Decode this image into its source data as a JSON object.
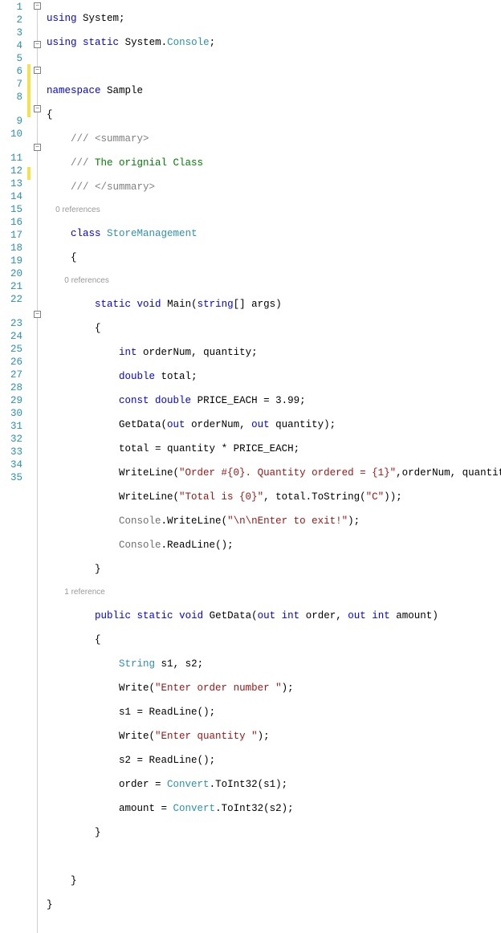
{
  "code": {
    "kw_using": "using",
    "kw_static": "static",
    "kw_namespace": "namespace",
    "kw_class": "class",
    "kw_void": "void",
    "kw_string": "string",
    "kw_int": "int",
    "kw_double": "double",
    "kw_const": "const",
    "kw_out": "out",
    "kw_public": "public",
    "ns_system": "System",
    "ns_console": "Console",
    "ns_name": "Sample",
    "class_name": "StoreManagement",
    "method_main": "Main",
    "method_getdata": "GetData",
    "type_string_cap": "String",
    "type_convert": "Convert",
    "summary_open": "<summary>",
    "summary_close": "</summary>",
    "triple_slash": "/// ",
    "summary_text": "The orignial Class",
    "var_args": "args",
    "var_orderNum": "orderNum",
    "var_quantity": "quantity",
    "var_total": "total",
    "var_price": "PRICE_EACH",
    "var_order": "order",
    "var_amount": "amount",
    "var_s1": "s1",
    "var_s2": "s2",
    "lit_price": "3.99",
    "str_order": "\"Order #{0}. Quantity ordered = {1}\"",
    "str_total": "\"Total is {0}\"",
    "str_c": "\"C\"",
    "str_enter_exit": "\"\\n\\nEnter to exit!\"",
    "str_enter_order": "\"Enter order number \"",
    "str_enter_qty": "\"Enter quantity \"",
    "fn_writeline": "WriteLine",
    "fn_readline": "ReadLine",
    "fn_write": "Write",
    "fn_tostring": "ToString",
    "fn_toint32": "ToInt32",
    "punc_semi": ";",
    "punc_dot": ".",
    "punc_comma": ", ",
    "punc_lbrace": "{",
    "punc_rbrace": "}",
    "punc_lparen": "(",
    "punc_rparen": ")",
    "punc_lbracket": "[",
    "punc_rbracket": "]",
    "punc_eq": " = ",
    "punc_star": " * "
  },
  "codelens": {
    "zero_ref": "0 references",
    "one_ref": "1 reference"
  },
  "lines": [
    "1",
    "2",
    "3",
    "4",
    "5",
    "6",
    "7",
    "8",
    "9",
    "10",
    "11",
    "12",
    "13",
    "14",
    "15",
    "16",
    "17",
    "18",
    "19",
    "20",
    "21",
    "22",
    "23",
    "24",
    "25",
    "26",
    "27",
    "28",
    "29",
    "30",
    "31",
    "32",
    "33",
    "34",
    "35"
  ],
  "fold_minus": "−"
}
